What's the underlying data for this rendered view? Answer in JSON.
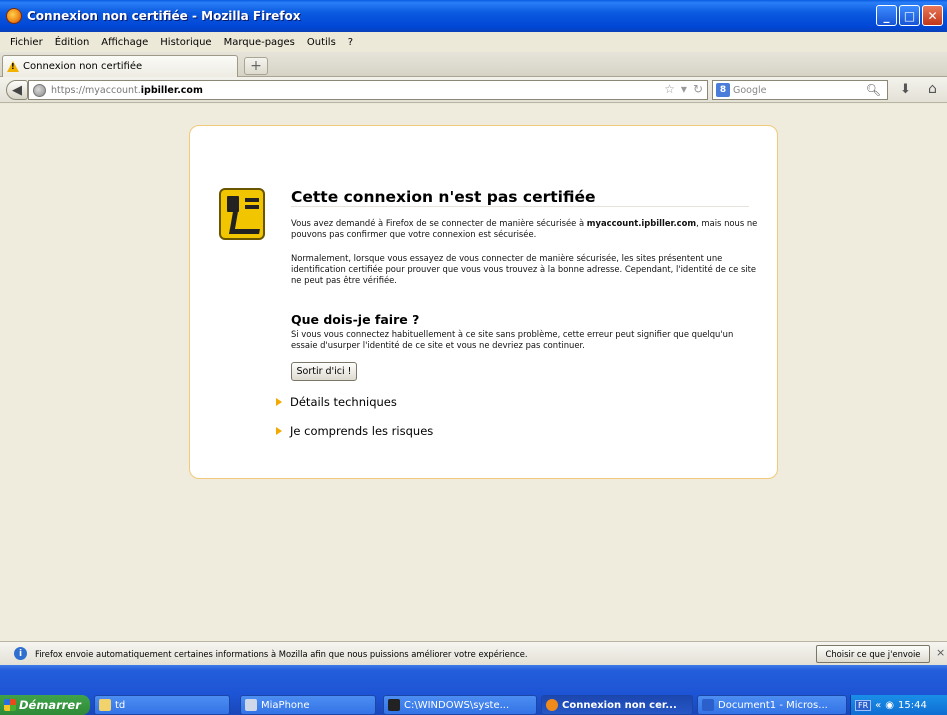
{
  "window": {
    "title": "Connexion non certifiée - Mozilla Firefox",
    "buttons": [
      "_",
      "□",
      "✕"
    ]
  },
  "menu": [
    "Fichier",
    "Édition",
    "Affichage",
    "Historique",
    "Marque-pages",
    "Outils",
    "?"
  ],
  "tabs": [
    {
      "label": "Connexion non certifiée",
      "icon": "warning-icon"
    }
  ],
  "newtab_label": "+",
  "nav": {
    "url_prefix": "https://myaccount.",
    "url_host": "ipbiller.com",
    "search_placeholder": "Google",
    "search_engine_letter": "8"
  },
  "error_page": {
    "title": "Cette connexion n'est pas certifiée",
    "p1_prefix": "Vous avez demandé à Firefox de se connecter de manière sécurisée à ",
    "p1_host": "myaccount.ipbiller.com",
    "p1_suffix": ", mais nous ne pouvons pas confirmer que votre connexion est sécurisée.",
    "p2": "Normalement, lorsque vous essayez de vous connecter de manière sécurisée, les sites présentent une identification certifiée pour prouver que vous vous trouvez à la bonne adresse. Cependant, l'identité de ce site ne peut pas être vérifiée.",
    "subtitle": "Que dois-je faire ?",
    "p3": "Si vous vous connectez habituellement à ce site sans problème, cette erreur peut signifier que quelqu'un essaie d'usurper l'identité de ce site et vous ne devriez pas continuer.",
    "button": "Sortir d'ici !",
    "expanders": [
      "Détails techniques",
      "Je comprends les risques"
    ]
  },
  "notification": {
    "text": "Firefox envoie automatiquement certaines informations à Mozilla afin que nous puissions améliorer votre expérience.",
    "button": "Choisir ce que j'envoie",
    "close": "×"
  },
  "taskbar": {
    "start": "Démarrer",
    "tasks": [
      {
        "label": "td",
        "icon": "folder-icon",
        "color": "#f2d36b"
      },
      {
        "label": "MiaPhone",
        "icon": "phone-icon",
        "color": "#cfd8e8"
      },
      {
        "label": "C:\\WINDOWS\\syste...",
        "icon": "console-icon",
        "color": "#222222"
      },
      {
        "label": "Connexion non cer...",
        "icon": "firefox-icon",
        "color": "#f08a1a"
      },
      {
        "label": "Document1 - Micros...",
        "icon": "word-icon",
        "color": "#2a5fcc"
      }
    ],
    "lang": "FR",
    "chevron": "«",
    "clock": "15:44"
  },
  "colors": {
    "title_bar": "#0046d5",
    "card_border": "#f0c97a",
    "page_bg": "#f0ecdd",
    "warning_yellow": "#f1c500",
    "expander_arrow": "#f2a900"
  }
}
